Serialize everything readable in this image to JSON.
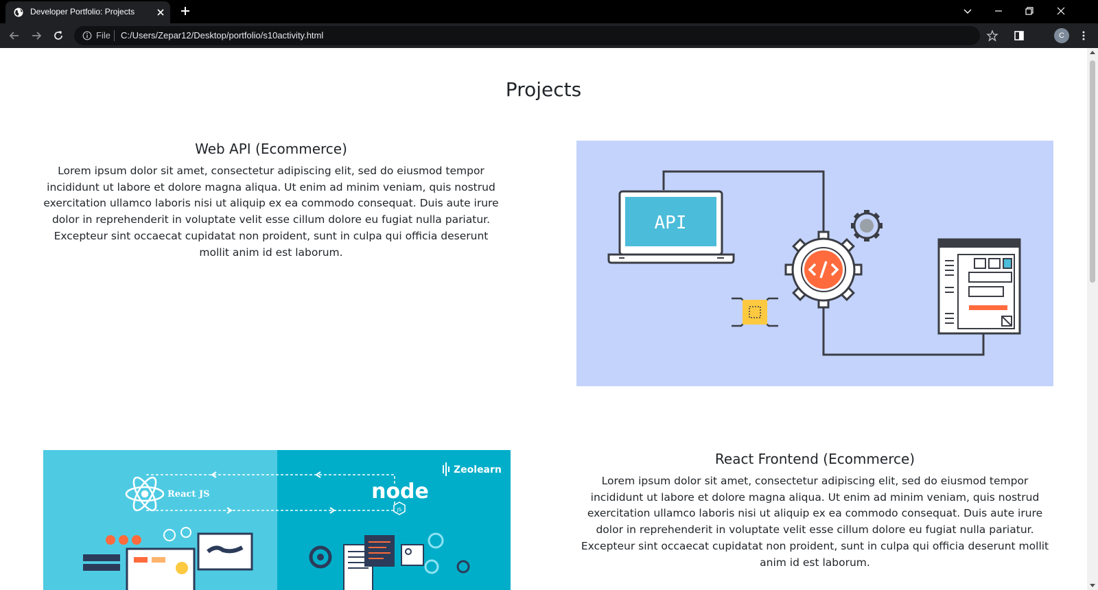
{
  "browser": {
    "tab_title": "Developer Portfolio: Projects",
    "omnibox_scheme": "File",
    "url": "C:/Users/Zepar12/Desktop/portfolio/s10activity.html",
    "profile_initial": "C"
  },
  "page": {
    "title": "Projects",
    "projects": [
      {
        "heading": "Web API (Ecommerce)",
        "description": "Lorem ipsum dolor sit amet, consectetur adipiscing elit, sed do eiusmod tempor incididunt ut labore et dolore magna aliqua. Ut enim ad minim veniam, quis nostrud exercitation ullamco laboris nisi ut aliquip ex ea commodo consequat. Duis aute irure dolor in reprehenderit in voluptate velit esse cillum dolore eu fugiat nulla pariatur. Excepteur sint occaecat cupidatat non proident, sunt in culpa qui officia deserunt mollit anim id est laborum.",
        "image_text": "API"
      },
      {
        "heading": "React Frontend (Ecommerce)",
        "description": "Lorem ipsum dolor sit amet, consectetur adipiscing elit, sed do eiusmod tempor incididunt ut labore et dolore magna aliqua. Ut enim ad minim veniam, quis nostrud exercitation ullamco laboris nisi ut aliquip ex ea commodo consequat. Duis aute irure dolor in reprehenderit in voluptate velit esse cillum dolore eu fugiat nulla pariatur. Excepteur sint occaecat cupidatat non proident, sunt in culpa qui officia deserunt mollit anim id est laborum.",
        "image_texts": {
          "brand": "Zeolearn",
          "left_label": "React JS",
          "right_logo": "node",
          "right_logo_badge": "JS"
        }
      }
    ]
  },
  "colors": {
    "api_bg": "#c3d3fc",
    "react_left_bg": "#4ecbe3",
    "react_right_bg": "#00aec9",
    "accent_orange": "#ff6b3d",
    "screen_blue": "#4bbcd9"
  }
}
